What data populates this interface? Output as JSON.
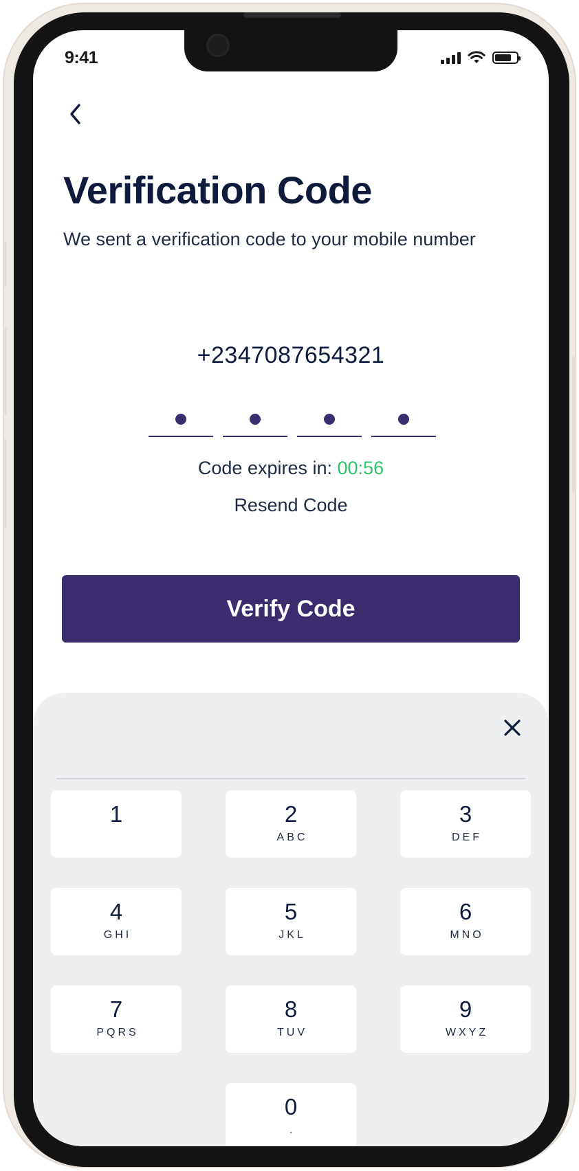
{
  "status_bar": {
    "time": "9:41",
    "icons": [
      "signal-icon",
      "wifi-icon",
      "battery-icon"
    ]
  },
  "header": {
    "back_icon": "chevron-left-icon"
  },
  "main": {
    "title": "Verification Code",
    "subtitle": "We sent a verification code to your mobile number",
    "phone_number": "+2347087654321",
    "code_slots_filled": 4,
    "code_slots_total": 4,
    "expiry_label": "Code expires in:",
    "expiry_time": "00:56",
    "resend_label": "Resend Code",
    "verify_label": "Verify Code"
  },
  "keypad": {
    "close_icon": "close-icon",
    "keys": [
      {
        "digit": "1",
        "letters": ""
      },
      {
        "digit": "2",
        "letters": "ABC"
      },
      {
        "digit": "3",
        "letters": "DEF"
      },
      {
        "digit": "4",
        "letters": "GHI"
      },
      {
        "digit": "5",
        "letters": "JKL"
      },
      {
        "digit": "6",
        "letters": "MNO"
      },
      {
        "digit": "7",
        "letters": "PQRS"
      },
      {
        "digit": "8",
        "letters": "TUV"
      },
      {
        "digit": "9",
        "letters": "WXYZ"
      },
      {
        "digit": "0",
        "letters": "."
      }
    ]
  },
  "colors": {
    "primary": "#3a2c6d",
    "title_text": "#0f1b3d",
    "expiry_green": "#2ec46b",
    "keypad_bg": "#eeeff1",
    "frame": "#efe9e4"
  }
}
